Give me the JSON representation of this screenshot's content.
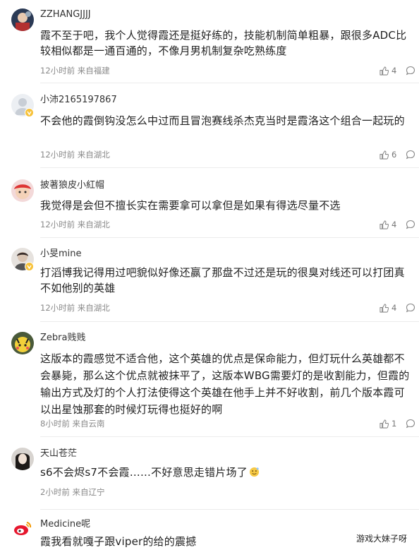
{
  "comments": [
    {
      "user": "ZZHANGJJJJ",
      "text": "霞不至于吧，我个人觉得霞还是挺好练的，技能机制简单粗暴，跟很多ADC比较相似都是一通百通的，不像月男机制复杂吃熟练度",
      "time": "12小时前",
      "location": "来自福建",
      "likes": "4"
    },
    {
      "user": "小沛2165197867",
      "text": "不会他的霞倒钩没怎么中过而且冒泡赛线杀杰克当时是霞洛这个组合一起玩的",
      "time": "12小时前",
      "location": "来自湖北",
      "likes": "6"
    },
    {
      "user": "披著狼皮小紅帽",
      "text": "我觉得是会但不擅长实在需要拿可以拿但是如果有得选尽量不选",
      "time": "12小时前",
      "location": "来自湖北",
      "likes": "4"
    },
    {
      "user": "小旻mine",
      "text": "打滔博我记得用过吧貌似好像还赢了那盘不过还是玩的很臭对线还可以打团真不如他别的英雄",
      "time": "12小时前",
      "location": "来自湖北",
      "likes": "4"
    },
    {
      "user": "Zebra贱贱",
      "text": "这版本的霞感觉不适合他，这个英雄的优点是保命能力，但灯玩什么英雄都不会暴毙，那么这个优点就被抹平了，这版本WBG需要灯的是收割能力，但霞的输出方式及灯的个人打法使得这个英雄在他手上并不好收割，前几个版本霞可以出星蚀那套的时候灯玩得也挺好的啊",
      "time": "8小时前",
      "location": "来自云南",
      "likes": "1"
    },
    {
      "user": "天山苍茫",
      "text": "s6不会烬s7不会霞……不好意思走错片场了",
      "time": "2小时前",
      "location": "来自辽宁",
      "likes": ""
    },
    {
      "user": "Medicine呢",
      "text": "霞我看就嘎子跟viper的给的震撼",
      "time": "",
      "location": "",
      "likes": ""
    }
  ],
  "watermark": "游戏大妹子呀",
  "colors": {
    "badge": "#f7c23a",
    "meta": "#8a8a8a",
    "text": "#222222"
  }
}
